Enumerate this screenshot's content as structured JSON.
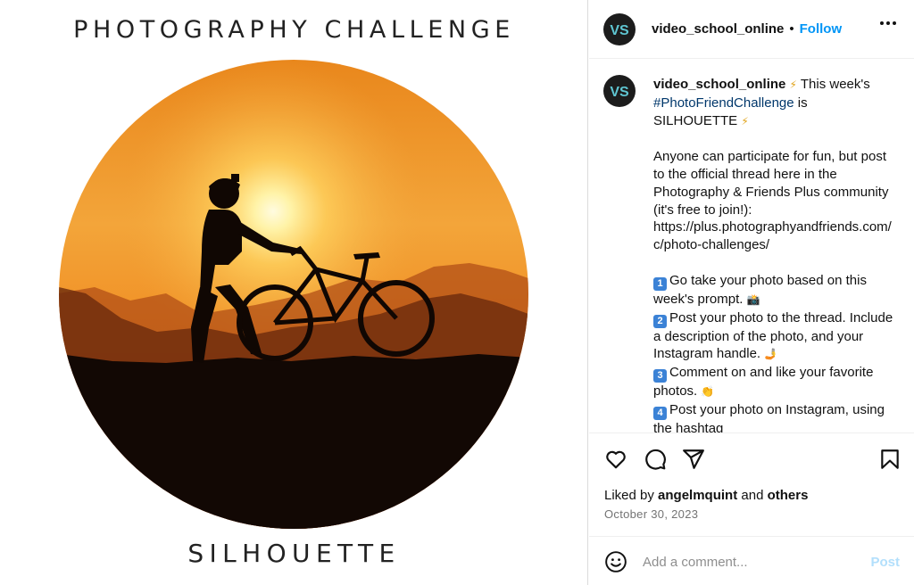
{
  "media": {
    "title": "PHOTOGRAPHY CHALLENGE",
    "subtitle": "SILHOUETTE"
  },
  "header": {
    "username": "video_school_online",
    "separator": "•",
    "follow_label": "Follow",
    "avatar_initials": "VS"
  },
  "caption": {
    "username": "video_school_online",
    "line1_text": " This week's ",
    "hashtag": "#PhotoFriendChallenge",
    "line1_end": " is",
    "theme": "SILHOUETTE",
    "para2": "Anyone can participate for fun, but post to the official thread here in the Photography & Friends Plus community (it's free to join!): https://plus.photographyandfriends.com/c/photo-challenges/",
    "steps": [
      {
        "number": "1",
        "text": "Go take your photo based on this week's prompt."
      },
      {
        "number": "2",
        "text": "Post your photo to the thread. Include a description of the photo, and your Instagram handle."
      },
      {
        "number": "3",
        "text": "Comment on and like your favorite photos."
      },
      {
        "number": "4",
        "text": "Post your photo on Instagram, using the hashtag"
      }
    ]
  },
  "likes": {
    "prefix": "Liked by ",
    "user": "angelmquint",
    "middle": " and ",
    "others": "others"
  },
  "date": "October 30, 2023",
  "comment": {
    "placeholder": "Add a comment...",
    "post_label": "Post"
  },
  "icons": {
    "like": "heart-icon",
    "comment": "comment-icon",
    "share": "share-icon",
    "save": "bookmark-icon",
    "emoji": "smile-icon",
    "more": "more-icon"
  },
  "colors": {
    "follow": "#0095f6",
    "hashtag": "#00376b",
    "post_disabled": "#b2dffc",
    "avatar_bg": "#1c1c1c",
    "avatar_fg": "#5fc6d2",
    "sunset_top": "#f09a2a",
    "sunset_glow": "#fff2a8"
  }
}
